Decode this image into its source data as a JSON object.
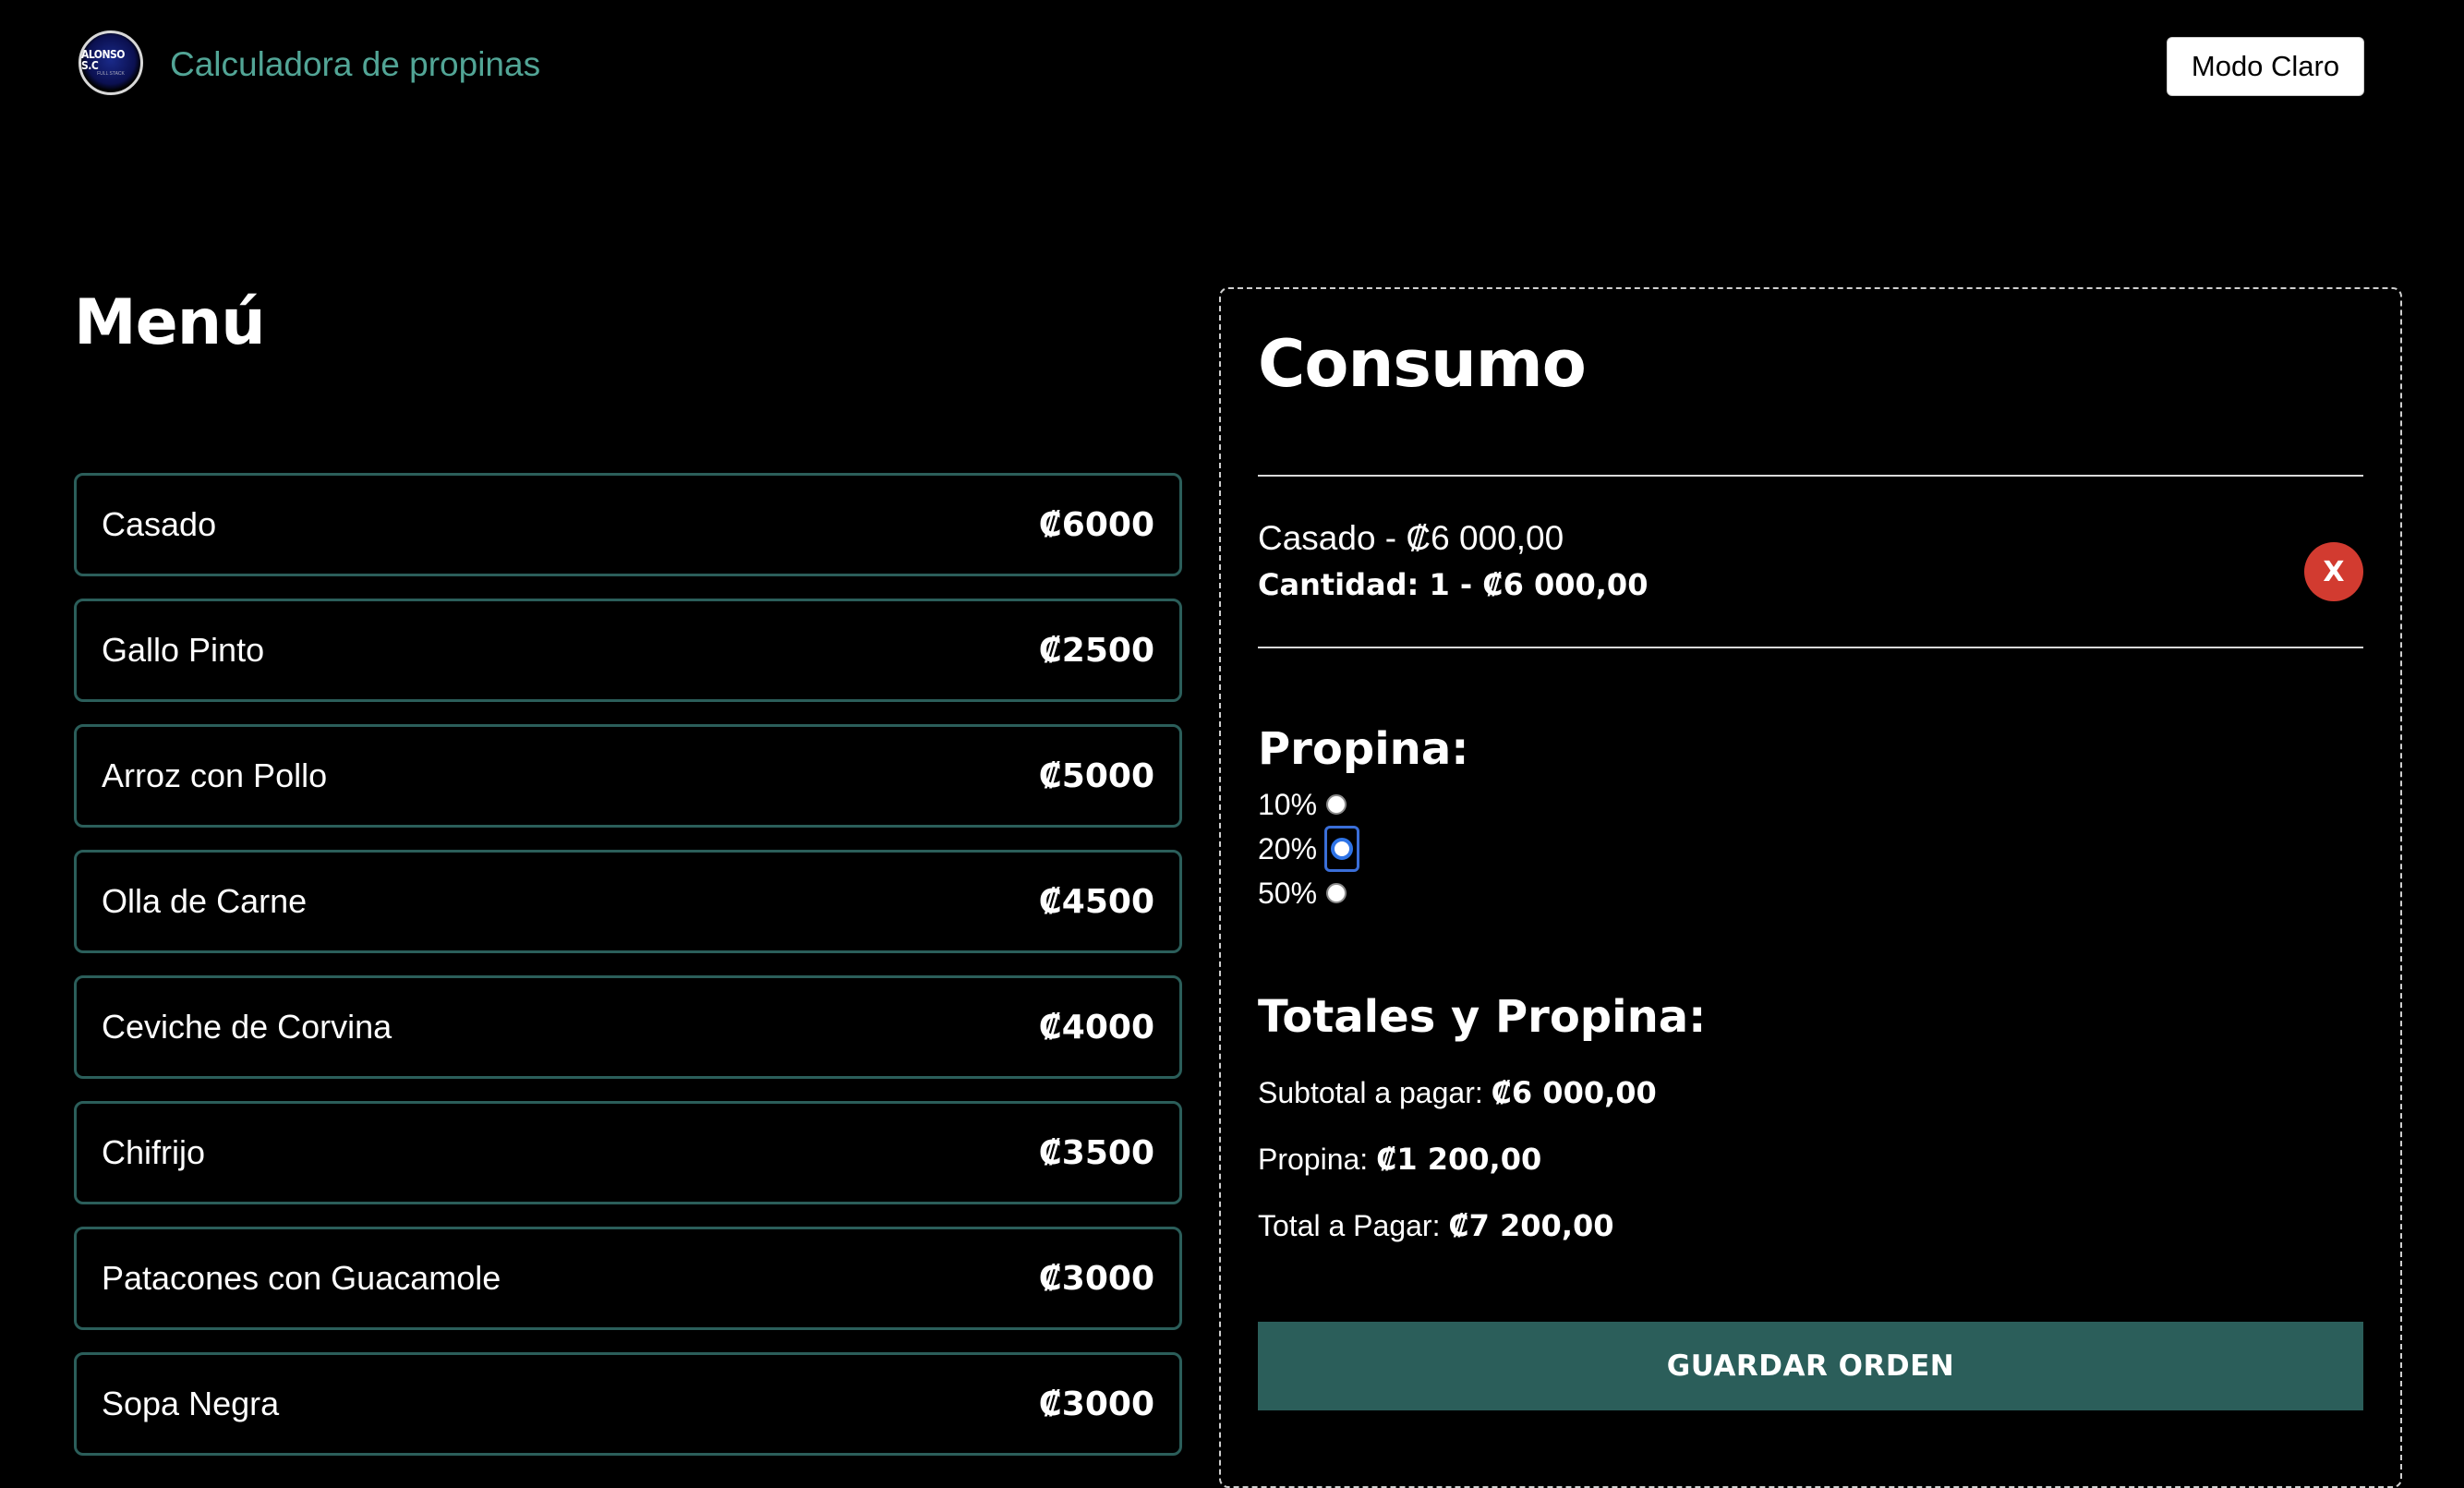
{
  "header": {
    "logo_text": "ALONSO S.C",
    "logo_subtext": "FULL STACK",
    "title": "Calculadora de propinas",
    "mode_button_label": "Modo Claro"
  },
  "menu": {
    "heading": "Menú",
    "items": [
      {
        "name": "Casado",
        "price": "₡6000"
      },
      {
        "name": "Gallo Pinto",
        "price": "₡2500"
      },
      {
        "name": "Arroz con Pollo",
        "price": "₡5000"
      },
      {
        "name": "Olla de Carne",
        "price": "₡4500"
      },
      {
        "name": "Ceviche de Corvina",
        "price": "₡4000"
      },
      {
        "name": "Chifrijo",
        "price": "₡3500"
      },
      {
        "name": "Patacones con Guacamole",
        "price": "₡3000"
      },
      {
        "name": "Sopa Negra",
        "price": "₡3000"
      }
    ]
  },
  "consumo": {
    "heading": "Consumo",
    "order_items": [
      {
        "name_price": "Casado - ₡6 000,00",
        "quantity_line": "Cantidad: 1 - ₡6 000,00",
        "remove_label": "X"
      }
    ],
    "propina_heading": "Propina:",
    "tip_options": [
      {
        "label": "10%",
        "selected": false
      },
      {
        "label": "20%",
        "selected": true
      },
      {
        "label": "50%",
        "selected": false
      }
    ],
    "totales_heading": "Totales y Propina:",
    "subtotal_label": "Subtotal a pagar:",
    "subtotal_value": "₡6 000,00",
    "propina_label": "Propina:",
    "propina_value": "₡1 200,00",
    "total_label": "Total a Pagar:",
    "total_value": "₡7 200,00",
    "save_button_label": "GUARDAR ORDEN"
  },
  "colors": {
    "background": "#000000",
    "accent_title": "#52a596",
    "item_border": "#2b5e5a",
    "save_button_bg": "#2b5e5a",
    "remove_button_bg": "#d23b30"
  }
}
